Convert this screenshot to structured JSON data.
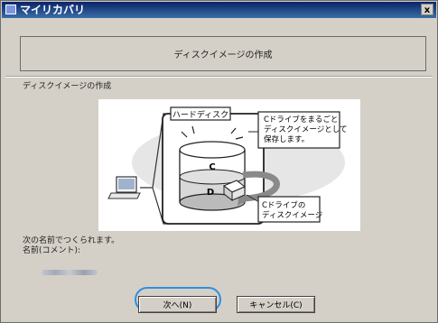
{
  "window": {
    "title": "マイリカバリ",
    "close_label": "x"
  },
  "header": {
    "title": "ディスクイメージの作成"
  },
  "subtitle": "ディスクイメージの作成",
  "illustration": {
    "harddisk_label": "ハードディスク",
    "drive_c": "C",
    "drive_d": "D",
    "callout_top": [
      "Cドライブをまるごと",
      "ディスクイメージとして",
      "保存します。"
    ],
    "callout_bottom": [
      "Cドライブの",
      "ディスクイメージ"
    ]
  },
  "labels": {
    "line1": "次の名前でつくられます。",
    "line2": "名前(コメント):"
  },
  "buttons": {
    "next": "次へ(N)",
    "cancel": "キャンセル(C)"
  },
  "colors": {
    "focus": "#2f8fe0",
    "titlebar": "#0a246a"
  }
}
